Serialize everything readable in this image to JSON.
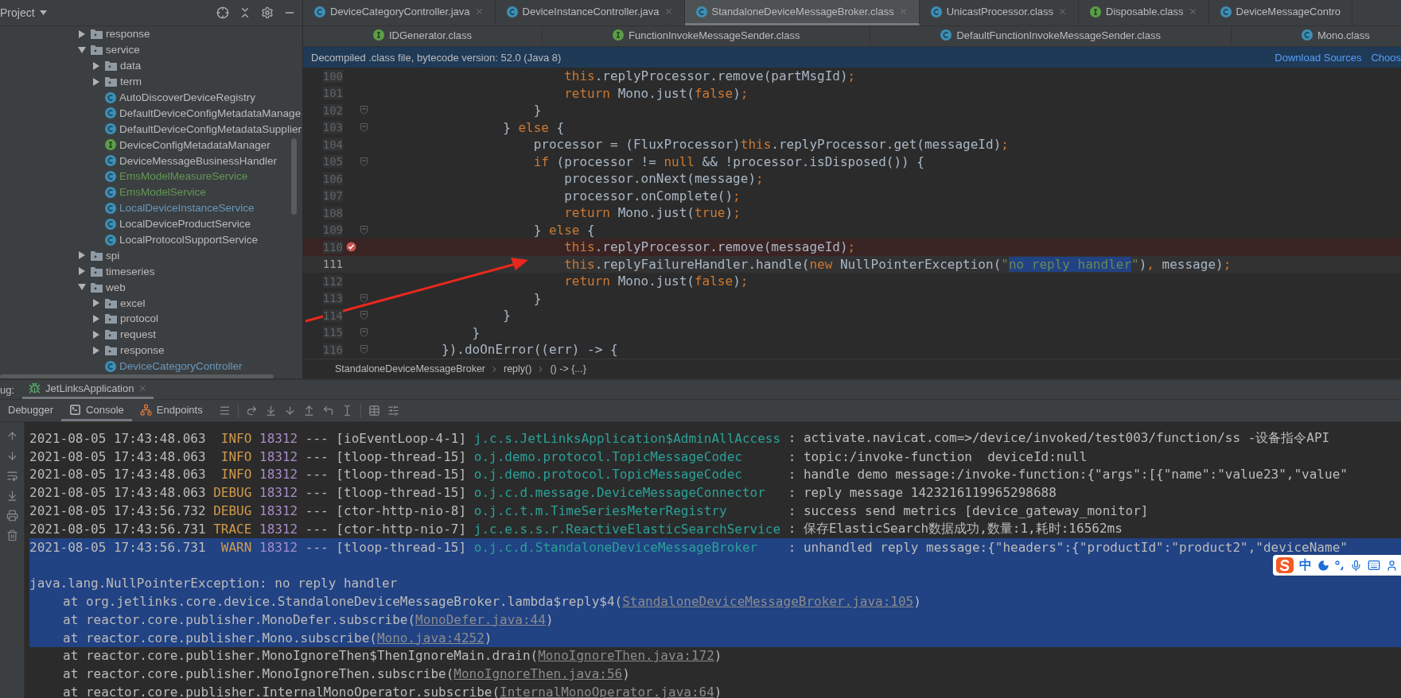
{
  "project_panel": {
    "title": "Project",
    "tree": [
      {
        "kind": "folder",
        "name": "response",
        "expanded": false
      },
      {
        "kind": "folder",
        "name": "service",
        "expanded": true,
        "children": [
          {
            "kind": "folder",
            "name": "data",
            "expanded": false
          },
          {
            "kind": "folder",
            "name": "term",
            "expanded": false
          },
          {
            "kind": "class",
            "name": "AutoDiscoverDeviceRegistry",
            "color": "#bbbbbb"
          },
          {
            "kind": "class",
            "name": "DefaultDeviceConfigMetadataManage",
            "color": "#bbbbbb"
          },
          {
            "kind": "class",
            "name": "DefaultDeviceConfigMetadataSupplier",
            "color": "#bbbbbb"
          },
          {
            "kind": "interface",
            "name": "DeviceConfigMetadataManager",
            "color": "#bbbbbb"
          },
          {
            "kind": "class",
            "name": "DeviceMessageBusinessHandler",
            "color": "#bbbbbb"
          },
          {
            "kind": "class",
            "name": "EmsModelMeasureService",
            "color": "#629755"
          },
          {
            "kind": "class",
            "name": "EmsModelService",
            "color": "#629755"
          },
          {
            "kind": "class",
            "name": "LocalDeviceInstanceService",
            "color": "#6897bb"
          },
          {
            "kind": "class",
            "name": "LocalDeviceProductService",
            "color": "#bbbbbb"
          },
          {
            "kind": "class",
            "name": "LocalProtocolSupportService",
            "color": "#bbbbbb"
          }
        ]
      },
      {
        "kind": "folder",
        "name": "spi",
        "expanded": false
      },
      {
        "kind": "folder",
        "name": "timeseries",
        "expanded": false
      },
      {
        "kind": "folder",
        "name": "web",
        "expanded": true,
        "children": [
          {
            "kind": "folder",
            "name": "excel",
            "expanded": false
          },
          {
            "kind": "folder",
            "name": "protocol",
            "expanded": false
          },
          {
            "kind": "folder",
            "name": "request",
            "expanded": false
          },
          {
            "kind": "folder",
            "name": "response",
            "expanded": false
          },
          {
            "kind": "class",
            "name": "DeviceCategoryController",
            "color": "#6897bb"
          }
        ]
      }
    ]
  },
  "editor": {
    "tab_rows": [
      {
        "tabs": [
          {
            "label": "DeviceCategoryController.java",
            "kind": "class",
            "selected": false,
            "closable": true
          },
          {
            "label": "DeviceInstanceController.java",
            "kind": "class",
            "selected": false,
            "closable": true
          },
          {
            "label": "StandaloneDeviceMessageBroker.class",
            "kind": "class",
            "selected": true,
            "closable": true
          },
          {
            "label": "UnicastProcessor.class",
            "kind": "class",
            "selected": false,
            "closable": true
          },
          {
            "label": "Disposable.class",
            "kind": "interface",
            "selected": false,
            "closable": true
          },
          {
            "label": "DeviceMessageContro",
            "kind": "class",
            "selected": false,
            "closable": false
          }
        ]
      },
      {
        "tabs": [
          {
            "label": "IDGenerator.class",
            "kind": "interface",
            "selected": false,
            "closable": false
          },
          {
            "label": "FunctionInvokeMessageSender.class",
            "kind": "interface",
            "selected": false,
            "closable": false
          },
          {
            "label": "DefaultFunctionInvokeMessageSender.class",
            "kind": "class",
            "selected": false,
            "closable": false
          },
          {
            "label": "Mono.class",
            "kind": "class",
            "selected": false,
            "closable": false
          }
        ]
      }
    ],
    "banner": {
      "text": "Decompiled .class file, bytecode version: 52.0 (Java 8)",
      "links": [
        "Download Sources",
        "Choos"
      ]
    },
    "lines": [
      {
        "number": "100",
        "breakpoint": false,
        "caret": false,
        "fold": false,
        "tokens": [
          {
            "kind": "keyword",
            "text": "                        this"
          },
          {
            "kind": "plain",
            "text": ".replyProcessor.remove(partMsgId)"
          },
          {
            "kind": "keyword",
            "text": ";"
          }
        ]
      },
      {
        "number": "101",
        "breakpoint": false,
        "caret": false,
        "fold": false,
        "tokens": [
          {
            "kind": "keyword",
            "text": "                        return "
          },
          {
            "kind": "plain",
            "text": "Mono.just("
          },
          {
            "kind": "keyword",
            "text": "false"
          },
          {
            "kind": "plain",
            "text": ")"
          },
          {
            "kind": "keyword",
            "text": ";"
          }
        ]
      },
      {
        "number": "102",
        "breakpoint": false,
        "caret": false,
        "fold": true,
        "tokens": [
          {
            "kind": "plain",
            "text": "                    }"
          }
        ]
      },
      {
        "number": "103",
        "breakpoint": false,
        "caret": false,
        "fold": true,
        "tokens": [
          {
            "kind": "plain",
            "text": "                } "
          },
          {
            "kind": "keyword",
            "text": "else "
          },
          {
            "kind": "plain",
            "text": "{"
          }
        ]
      },
      {
        "number": "104",
        "breakpoint": false,
        "caret": false,
        "fold": false,
        "tokens": [
          {
            "kind": "plain",
            "text": "                    processor = (FluxProcessor)"
          },
          {
            "kind": "keyword",
            "text": "this"
          },
          {
            "kind": "plain",
            "text": ".replyProcessor.get(messageId)"
          },
          {
            "kind": "keyword",
            "text": ";"
          }
        ]
      },
      {
        "number": "105",
        "breakpoint": false,
        "caret": false,
        "fold": true,
        "tokens": [
          {
            "kind": "keyword",
            "text": "                    if "
          },
          {
            "kind": "plain",
            "text": "(processor != "
          },
          {
            "kind": "keyword",
            "text": "null "
          },
          {
            "kind": "plain",
            "text": "&& !processor.isDisposed()) {"
          }
        ]
      },
      {
        "number": "106",
        "breakpoint": false,
        "caret": false,
        "fold": false,
        "tokens": [
          {
            "kind": "plain",
            "text": "                        processor.onNext(message)"
          },
          {
            "kind": "keyword",
            "text": ";"
          }
        ]
      },
      {
        "number": "107",
        "breakpoint": false,
        "caret": false,
        "fold": false,
        "tokens": [
          {
            "kind": "plain",
            "text": "                        processor.onComplete()"
          },
          {
            "kind": "keyword",
            "text": ";"
          }
        ]
      },
      {
        "number": "108",
        "breakpoint": false,
        "caret": false,
        "fold": false,
        "tokens": [
          {
            "kind": "keyword",
            "text": "                        return "
          },
          {
            "kind": "plain",
            "text": "Mono.just("
          },
          {
            "kind": "keyword",
            "text": "true"
          },
          {
            "kind": "plain",
            "text": ")"
          },
          {
            "kind": "keyword",
            "text": ";"
          }
        ]
      },
      {
        "number": "109",
        "breakpoint": false,
        "caret": false,
        "fold": true,
        "tokens": [
          {
            "kind": "plain",
            "text": "                    } "
          },
          {
            "kind": "keyword",
            "text": "else "
          },
          {
            "kind": "plain",
            "text": "{"
          }
        ]
      },
      {
        "number": "110",
        "breakpoint": true,
        "caret": false,
        "fold": false,
        "tokens": [
          {
            "kind": "keyword",
            "text": "                        this"
          },
          {
            "kind": "plain",
            "text": ".replyProcessor.remove(messageId)"
          },
          {
            "kind": "keyword",
            "text": ";"
          }
        ]
      },
      {
        "number": "111",
        "breakpoint": false,
        "caret": true,
        "fold": false,
        "tokens": [
          {
            "kind": "keyword",
            "text": "                        this"
          },
          {
            "kind": "plain",
            "text": ".replyFailureHandler.handle("
          },
          {
            "kind": "keyword",
            "text": "new "
          },
          {
            "kind": "plain",
            "text": "NullPointerException("
          },
          {
            "kind": "string",
            "text": "\""
          },
          {
            "kind": "match",
            "text": "no reply handler"
          },
          {
            "kind": "string",
            "text": "\""
          },
          {
            "kind": "plain",
            "text": ")"
          },
          {
            "kind": "keyword",
            "text": ", "
          },
          {
            "kind": "plain",
            "text": "message)"
          },
          {
            "kind": "keyword",
            "text": ";"
          }
        ]
      },
      {
        "number": "112",
        "breakpoint": false,
        "caret": false,
        "fold": false,
        "tokens": [
          {
            "kind": "keyword",
            "text": "                        return "
          },
          {
            "kind": "plain",
            "text": "Mono.just("
          },
          {
            "kind": "keyword",
            "text": "false"
          },
          {
            "kind": "plain",
            "text": ")"
          },
          {
            "kind": "keyword",
            "text": ";"
          }
        ]
      },
      {
        "number": "113",
        "breakpoint": false,
        "caret": false,
        "fold": true,
        "tokens": [
          {
            "kind": "plain",
            "text": "                    }"
          }
        ]
      },
      {
        "number": "114",
        "breakpoint": false,
        "caret": false,
        "fold": true,
        "tokens": [
          {
            "kind": "plain",
            "text": "                }"
          }
        ]
      },
      {
        "number": "115",
        "breakpoint": false,
        "caret": false,
        "fold": true,
        "tokens": [
          {
            "kind": "plain",
            "text": "            }"
          }
        ]
      },
      {
        "number": "116",
        "breakpoint": false,
        "caret": false,
        "fold": true,
        "tokens": [
          {
            "kind": "plain",
            "text": "        }).doOnError((err) -> {"
          }
        ]
      }
    ],
    "breadcrumbs": [
      "StandaloneDeviceMessageBroker",
      "reply()",
      "() -> {...}"
    ]
  },
  "debug": {
    "label": "ug:",
    "session_tab": "JetLinksApplication",
    "tabs": [
      {
        "label": "Debugger",
        "kind": "text",
        "selected": false
      },
      {
        "label": "Console",
        "kind": "console",
        "selected": true
      },
      {
        "label": "Endpoints",
        "kind": "endpoints",
        "selected": false
      }
    ]
  },
  "console": {
    "lines": [
      {
        "kind": "log",
        "selected": false,
        "date": "2021-08-05 17:43:48.063",
        "level": "INFO",
        "pid": "18312",
        "sep": "---",
        "thread": "[ioEventLoop-4-1]",
        "logger": "j.c.s.JetLinksApplication$AdminAllAccess",
        "message": ": activate.navicat.com=>/device/invoked/test003/function/ss -设备指令API"
      },
      {
        "kind": "log",
        "selected": false,
        "date": "2021-08-05 17:43:48.063",
        "level": "INFO",
        "pid": "18312",
        "sep": "---",
        "thread": "[tloop-thread-15]",
        "logger": "o.j.demo.protocol.TopicMessageCodec",
        "message": ": topic:/invoke-function  deviceId:null"
      },
      {
        "kind": "log",
        "selected": false,
        "date": "2021-08-05 17:43:48.063",
        "level": "INFO",
        "pid": "18312",
        "sep": "---",
        "thread": "[tloop-thread-15]",
        "logger": "o.j.demo.protocol.TopicMessageCodec",
        "message": ": handle demo message:/invoke-function:{\"args\":[{\"name\":\"value23\",\"value\""
      },
      {
        "kind": "log",
        "selected": false,
        "date": "2021-08-05 17:43:48.063",
        "level": "DEBUG",
        "pid": "18312",
        "sep": "---",
        "thread": "[tloop-thread-15]",
        "logger": "o.j.c.d.message.DeviceMessageConnector",
        "message": ": reply message 1423216119965298688"
      },
      {
        "kind": "log",
        "selected": false,
        "date": "2021-08-05 17:43:56.732",
        "level": "DEBUG",
        "pid": "18312",
        "sep": "---",
        "thread": "[ctor-http-nio-8]",
        "logger": "o.j.c.t.m.TimeSeriesMeterRegistry",
        "message": ": success send metrics [device_gateway_monitor]"
      },
      {
        "kind": "log",
        "selected": false,
        "date": "2021-08-05 17:43:56.731",
        "level": "TRACE",
        "pid": "18312",
        "sep": "---",
        "thread": "[ctor-http-nio-7]",
        "logger": "j.c.e.s.s.r.ReactiveElasticSearchService",
        "message": ": 保存ElasticSearch数据成功,数量:1,耗时:16562ms"
      },
      {
        "kind": "log",
        "selected": true,
        "date": "2021-08-05 17:43:56.731",
        "level": "WARN",
        "pid": "18312",
        "sep": "---",
        "thread": "[tloop-thread-15]",
        "logger": "o.j.c.d.StandaloneDeviceMessageBroker",
        "message": ": unhandled reply message:{\"headers\":{\"productId\":\"product2\",\"deviceName\""
      },
      {
        "kind": "blank",
        "selected": true
      },
      {
        "kind": "exception",
        "selected": true,
        "text": "java.lang.NullPointerException: no reply handler"
      },
      {
        "kind": "frame",
        "selected": true,
        "before": "at org.jetlinks.core.device.StandaloneDeviceMessageBroker.lambda$reply$4(",
        "link": "StandaloneDeviceMessageBroker.java:105",
        "after": ")"
      },
      {
        "kind": "frame",
        "selected": true,
        "before": "at reactor.core.publisher.MonoDefer.subscribe(",
        "link": "MonoDefer.java:44",
        "after": ")"
      },
      {
        "kind": "frame",
        "selected": true,
        "before": "at reactor.core.publisher.Mono.subscribe(",
        "link": "Mono.java:4252",
        "after": ")"
      },
      {
        "kind": "frame",
        "selected": false,
        "before": "at reactor.core.publisher.MonoIgnoreThen$ThenIgnoreMain.drain(",
        "link": "MonoIgnoreThen.java:172",
        "after": ")"
      },
      {
        "kind": "frame",
        "selected": false,
        "before": "at reactor.core.publisher.MonoIgnoreThen.subscribe(",
        "link": "MonoIgnoreThen.java:56",
        "after": ")"
      },
      {
        "kind": "frame",
        "selected": false,
        "before": "at reactor.core.publisher.InternalMonoOperator.subscribe(",
        "link": "InternalMonoOperator.java:64",
        "after": ")"
      }
    ]
  },
  "ime_toolbar": {
    "mode": "中"
  }
}
